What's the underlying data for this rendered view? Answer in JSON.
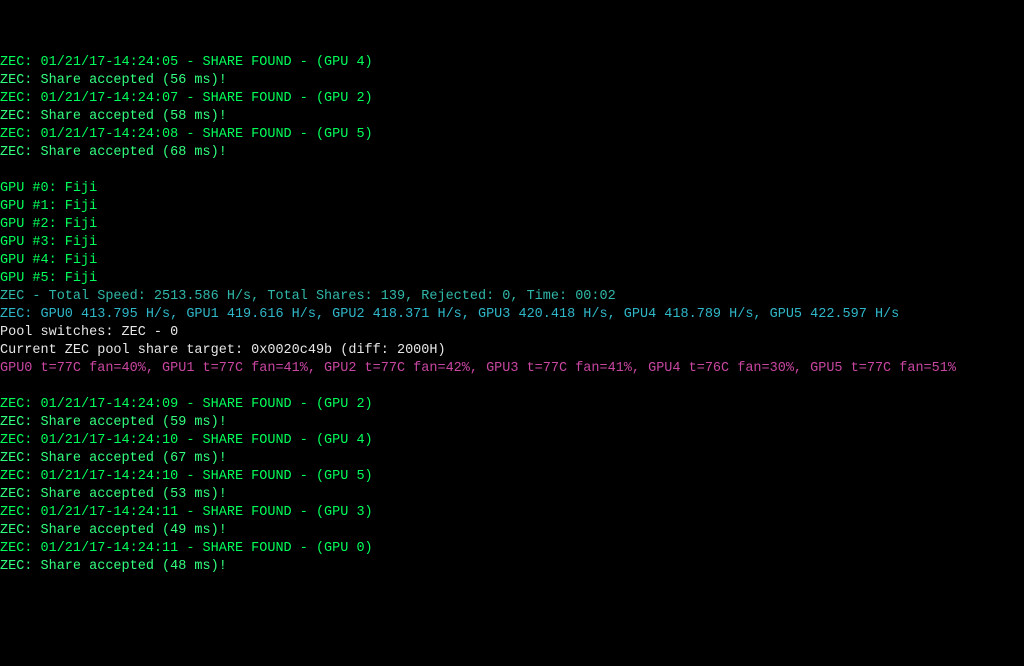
{
  "lines": [
    {
      "cls": "g-bright",
      "text": "ZEC: 01/21/17-14:24:05 - SHARE FOUND - (GPU 4)"
    },
    {
      "cls": "g-med",
      "text": "ZEC: Share accepted (56 ms)!"
    },
    {
      "cls": "g-bright",
      "text": "ZEC: 01/21/17-14:24:07 - SHARE FOUND - (GPU 2)"
    },
    {
      "cls": "g-med",
      "text": "ZEC: Share accepted (58 ms)!"
    },
    {
      "cls": "g-bright",
      "text": "ZEC: 01/21/17-14:24:08 - SHARE FOUND - (GPU 5)"
    },
    {
      "cls": "g-med",
      "text": "ZEC: Share accepted (68 ms)!"
    },
    {
      "cls": "",
      "text": " "
    },
    {
      "cls": "g-bright",
      "text": "GPU #0: Fiji"
    },
    {
      "cls": "g-bright",
      "text": "GPU #1: Fiji"
    },
    {
      "cls": "g-bright",
      "text": "GPU #2: Fiji"
    },
    {
      "cls": "g-bright",
      "text": "GPU #3: Fiji"
    },
    {
      "cls": "g-bright",
      "text": "GPU #4: Fiji"
    },
    {
      "cls": "g-bright",
      "text": "GPU #5: Fiji"
    },
    {
      "cls": "c-teal",
      "text": "ZEC - Total Speed: 2513.586 H/s, Total Shares: 139, Rejected: 0, Time: 00:02"
    },
    {
      "cls": "c-cyan",
      "text": "ZEC: GPU0 413.795 H/s, GPU1 419.616 H/s, GPU2 418.371 H/s, GPU3 420.418 H/s, GPU4 418.789 H/s, GPU5 422.597 H/s"
    },
    {
      "cls": "c-white",
      "text": "Pool switches: ZEC - 0"
    },
    {
      "cls": "c-white",
      "text": "Current ZEC pool share target: 0x0020c49b (diff: 2000H)"
    },
    {
      "cls": "c-mag",
      "text": "GPU0 t=77C fan=40%, GPU1 t=77C fan=41%, GPU2 t=77C fan=42%, GPU3 t=77C fan=41%, GPU4 t=76C fan=30%, GPU5 t=77C fan=51%"
    },
    {
      "cls": "",
      "text": " "
    },
    {
      "cls": "g-bright",
      "text": "ZEC: 01/21/17-14:24:09 - SHARE FOUND - (GPU 2)"
    },
    {
      "cls": "g-med",
      "text": "ZEC: Share accepted (59 ms)!"
    },
    {
      "cls": "g-bright",
      "text": "ZEC: 01/21/17-14:24:10 - SHARE FOUND - (GPU 4)"
    },
    {
      "cls": "g-med",
      "text": "ZEC: Share accepted (67 ms)!"
    },
    {
      "cls": "g-bright",
      "text": "ZEC: 01/21/17-14:24:10 - SHARE FOUND - (GPU 5)"
    },
    {
      "cls": "g-med",
      "text": "ZEC: Share accepted (53 ms)!"
    },
    {
      "cls": "g-bright",
      "text": "ZEC: 01/21/17-14:24:11 - SHARE FOUND - (GPU 3)"
    },
    {
      "cls": "g-med",
      "text": "ZEC: Share accepted (49 ms)!"
    },
    {
      "cls": "g-bright",
      "text": "ZEC: 01/21/17-14:24:11 - SHARE FOUND - (GPU 0)"
    },
    {
      "cls": "g-med",
      "text": "ZEC: Share accepted (48 ms)!"
    }
  ]
}
